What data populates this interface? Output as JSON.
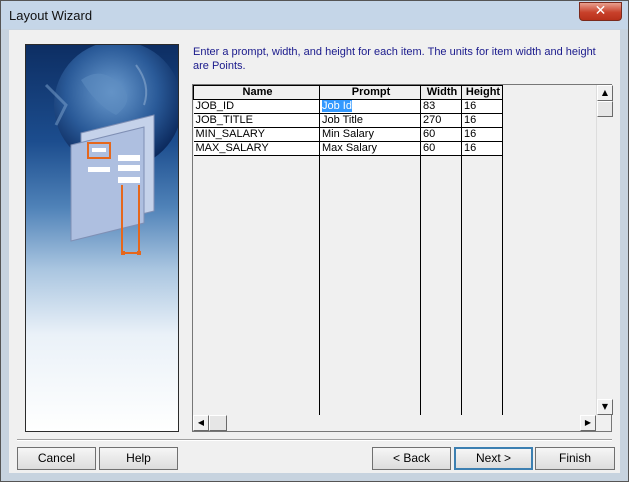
{
  "window": {
    "title": "Layout Wizard",
    "close_symbol": "✕"
  },
  "instructions": "Enter a prompt, width, and height for each item. The units for item width and height are Points.",
  "table": {
    "headers": [
      "Name",
      "Prompt",
      "Width",
      "Height"
    ],
    "rows": [
      {
        "name": "JOB_ID",
        "prompt": "Job Id",
        "width": "83",
        "height": "16"
      },
      {
        "name": "JOB_TITLE",
        "prompt": "Job Title",
        "width": "270",
        "height": "16"
      },
      {
        "name": "MIN_SALARY",
        "prompt": "Min Salary",
        "width": "60",
        "height": "16"
      },
      {
        "name": "MAX_SALARY",
        "prompt": "Max Salary",
        "width": "60",
        "height": "16"
      }
    ],
    "selected_cell": "Job Id"
  },
  "scrollbars": {
    "up_arrow": "▲",
    "down_arrow": "▼",
    "left_arrow": "◀",
    "right_arrow": "▶"
  },
  "buttons": {
    "cancel": "Cancel",
    "help": "Help",
    "back": "< Back",
    "next": "Next >",
    "finish": "Finish"
  },
  "icons": {
    "close": "close-icon",
    "wizard_art": "wizard-illustration"
  }
}
